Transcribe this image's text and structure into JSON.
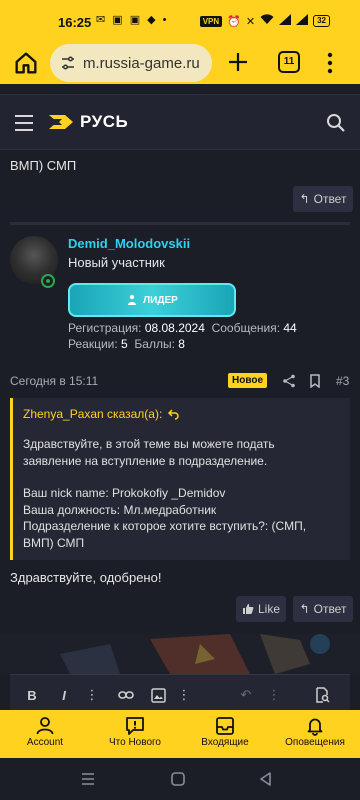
{
  "status_bar": {
    "time": "16:25",
    "notifications": "✉ ▣ ▣ ◆ •",
    "vpn": "VPN",
    "battery": "32"
  },
  "browser": {
    "url": "m.russia-game.ru",
    "tab_count": "11",
    "icons": [
      "home-icon",
      "tune-icon",
      "plus-icon",
      "tabs-icon",
      "more-vert-icon"
    ]
  },
  "site": {
    "logo_text": "РУСЬ"
  },
  "previous_post": {
    "text": "ВМП) СМП",
    "reply_label": "Ответ"
  },
  "post": {
    "author": {
      "name": "Demid_Molodovskii",
      "title": "Новый участник",
      "rank": "ЛИДЕР",
      "registration_label": "Регистрация:",
      "registration_value": "08.08.2024",
      "messages_label": "Сообщения:",
      "messages_value": "44",
      "reactions_label": "Реакции:",
      "reactions_value": "5",
      "points_label": "Баллы:",
      "points_value": "8"
    },
    "timestamp": "Сегодня в 15:11",
    "new_badge": "Новое",
    "number": "#3",
    "quote": {
      "author_line": "Zhenya_Paxan сказал(а):",
      "lines": [
        "Здравствуйте, в этой теме вы можете подать",
        "заявление на вступление в подразделение.",
        "",
        "Ваш nick name: Prokokofiy _Demidov",
        "Ваша должность: Мл.медработник",
        "Подразделение к которое хотите вступить?: (СМП,",
        "ВМП) СМП"
      ]
    },
    "body": "Здравствуйте, одобрено!",
    "like_label": "Like",
    "reply_label": "Ответ"
  },
  "bottom_nav": {
    "items": [
      {
        "label": "Account",
        "icon": "user-icon"
      },
      {
        "label": "Что Нового",
        "icon": "alert-box-icon"
      },
      {
        "label": "Входящие",
        "icon": "inbox-icon"
      },
      {
        "label": "Оповещения",
        "icon": "bell-icon"
      }
    ]
  },
  "colors": {
    "accent": "#ffd21f",
    "background": "#1b1e27",
    "username": "#2ed1ef",
    "rank": "#3cd0d9",
    "online": "#2aa84a"
  }
}
